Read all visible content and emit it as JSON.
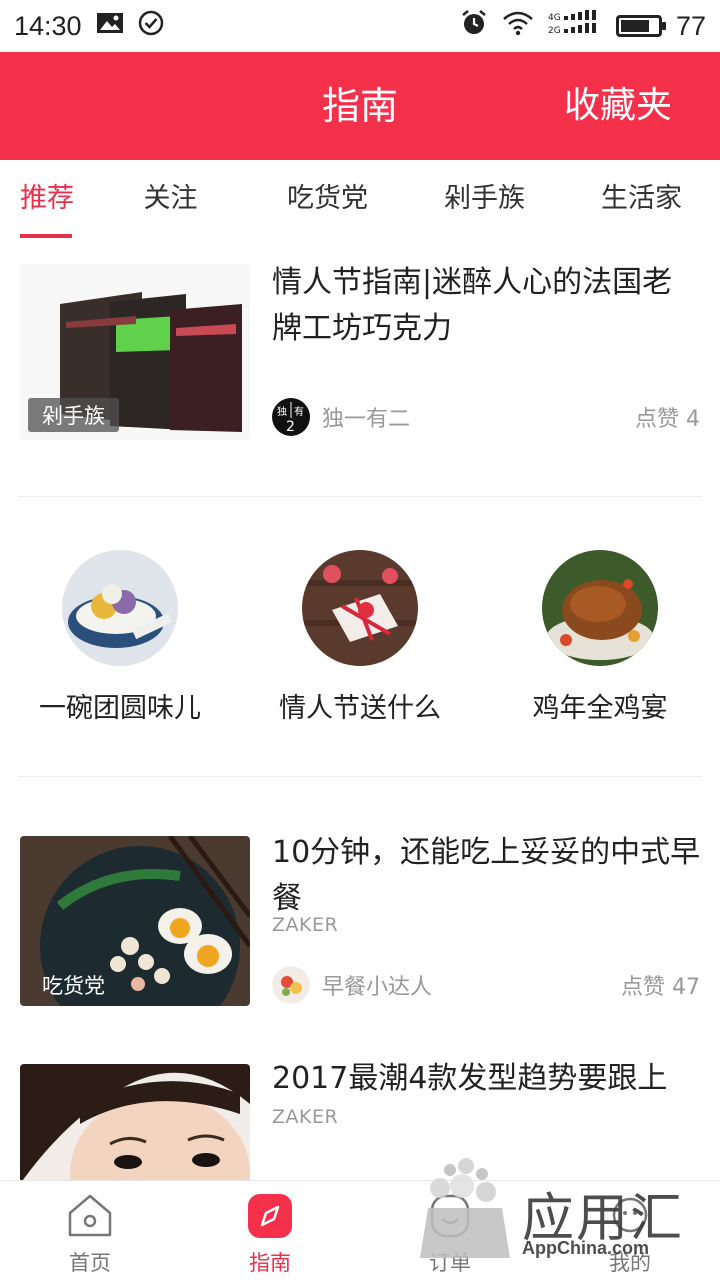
{
  "status_bar": {
    "time": "14:30",
    "network": "4G 2G",
    "battery": "77",
    "battery_level": 0.77
  },
  "header": {
    "title": "指南",
    "favorites": "收藏夹"
  },
  "tabs": [
    {
      "label": "推荐",
      "active": true
    },
    {
      "label": "关注"
    },
    {
      "label": "吃货党"
    },
    {
      "label": "剁手族"
    },
    {
      "label": "生活家"
    }
  ],
  "articles": [
    {
      "title": "情人节指南|迷醉人心的法国老牌工坊巧克力",
      "tag": "剁手族",
      "author": "独一有二",
      "avatar_text": "独",
      "avatar_text2": "有",
      "avatar_num": "2",
      "likes": "点赞 4",
      "source": ""
    },
    {
      "title": "10分钟，还能吃上妥妥的中式早餐",
      "tag": "吃货党",
      "source": "ZAKER",
      "author": "早餐小达人",
      "likes": "点赞 47"
    },
    {
      "title": "2017最潮4款发型趋势要跟上",
      "source": "ZAKER"
    }
  ],
  "topics": [
    {
      "label": "一碗团圆味儿"
    },
    {
      "label": "情人节送什么"
    },
    {
      "label": "鸡年全鸡宴"
    }
  ],
  "bottom_nav": [
    {
      "label": "首页",
      "icon": "home-icon"
    },
    {
      "label": "指南",
      "icon": "compass-icon",
      "active": true
    },
    {
      "label": "订单",
      "icon": "order-icon"
    },
    {
      "label": "我的",
      "icon": "profile-icon"
    }
  ],
  "watermark": {
    "text": "应用汇",
    "sub": "AppChina.com"
  },
  "colors": {
    "accent": "#f5304b",
    "active_tab": "#e8304a"
  }
}
